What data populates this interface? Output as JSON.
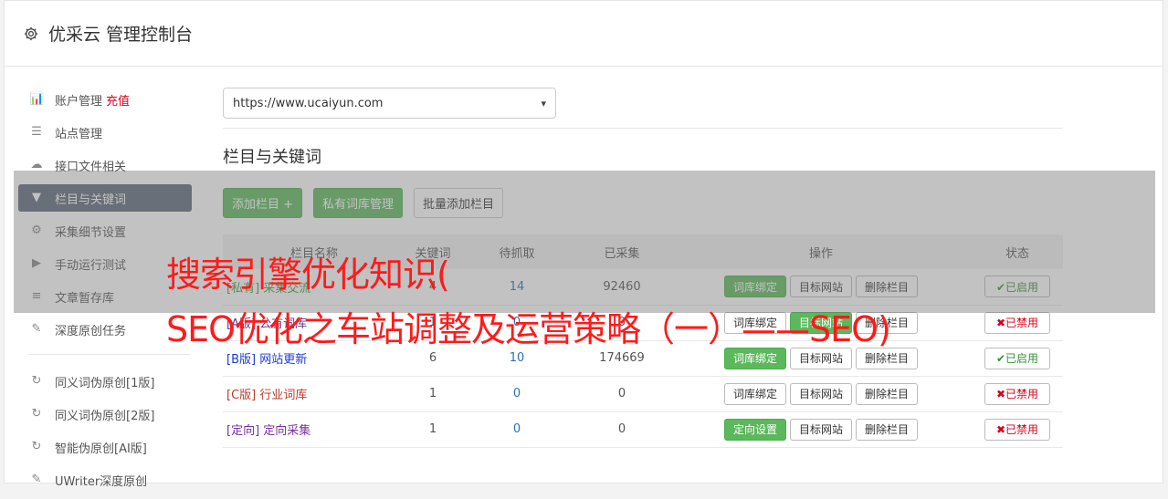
{
  "header": {
    "title": "优采云 管理控制台",
    "icon": "gear-icon"
  },
  "sidebar": {
    "items": [
      {
        "label": "账户管理",
        "icon": "bar-chart-icon",
        "extra": "充值"
      },
      {
        "label": "站点管理",
        "icon": "server-icon"
      },
      {
        "label": "接口文件相关",
        "icon": "cloud-upload-icon"
      },
      {
        "label": "栏目与关键词",
        "icon": "filter-icon",
        "active": true
      },
      {
        "label": "采集细节设置",
        "icon": "cogs-icon"
      },
      {
        "label": "手动运行测试",
        "icon": "play-circle-icon"
      },
      {
        "label": "文章暂存库",
        "icon": "database-icon"
      },
      {
        "label": "深度原创任务",
        "icon": "edit-icon"
      }
    ],
    "items2": [
      {
        "label": "同义词伪原创[1版]",
        "icon": "refresh-icon"
      },
      {
        "label": "同义词伪原创[2版]",
        "icon": "refresh-icon"
      },
      {
        "label": "智能伪原创[AI版]",
        "icon": "refresh-icon"
      },
      {
        "label": "UWriter深度原创",
        "icon": "edit-icon"
      }
    ]
  },
  "main": {
    "site_select": "https://www.ucaiyun.com",
    "section_title": "栏目与关键词",
    "buttons": {
      "add_column": "添加栏目 +",
      "private_lib": "私有词库管理",
      "batch_add": "批量添加栏目"
    },
    "table": {
      "headers": [
        "栏目名称",
        "关键词",
        "待抓取",
        "已采集",
        "操作",
        "状态"
      ],
      "rows": [
        {
          "name": "[私有] 采集交流",
          "keywords": "4",
          "pending": "14",
          "collected": "92460",
          "op1": "词库绑定",
          "op1_green": true,
          "op2": "目标网站",
          "op2_green": false,
          "op3": "删除栏目",
          "status": "✔已启用",
          "on": true,
          "cls": "n-private"
        },
        {
          "name": "[A版] 公有词库",
          "keywords": "1",
          "pending": "0",
          "collected": "0",
          "op1": "词库绑定",
          "op1_green": false,
          "op2": "目标网站",
          "op2_green": true,
          "op3": "删除栏目",
          "status": "✖已禁用",
          "on": false,
          "cls": "n-a"
        },
        {
          "name": "[B版] 网站更新",
          "keywords": "6",
          "pending": "10",
          "collected": "174669",
          "op1": "词库绑定",
          "op1_green": true,
          "op2": "目标网站",
          "op2_green": false,
          "op3": "删除栏目",
          "status": "✔已启用",
          "on": true,
          "cls": "n-b"
        },
        {
          "name": "[C版] 行业词库",
          "keywords": "1",
          "pending": "0",
          "collected": "0",
          "op1": "词库绑定",
          "op1_green": false,
          "op2": "目标网站",
          "op2_green": false,
          "op3": "删除栏目",
          "status": "✖已禁用",
          "on": false,
          "cls": "n-c"
        },
        {
          "name": "[定向] 定向采集",
          "keywords": "1",
          "pending": "0",
          "collected": "0",
          "op1": "定向设置",
          "op1_green": true,
          "op2": "目标网站",
          "op2_green": false,
          "op3": "删除栏目",
          "status": "✖已禁用",
          "on": false,
          "cls": "n-dir"
        }
      ]
    }
  },
  "overlay_text": {
    "line1": "搜索引擎优化知识(",
    "line2": "SEO优化之车站调整及运营策略（一）——SEO)"
  },
  "colors": {
    "accent_green": "#5cb85c",
    "active_sidebar": "#5d6878",
    "overlay_text": "#ff1a1a"
  }
}
